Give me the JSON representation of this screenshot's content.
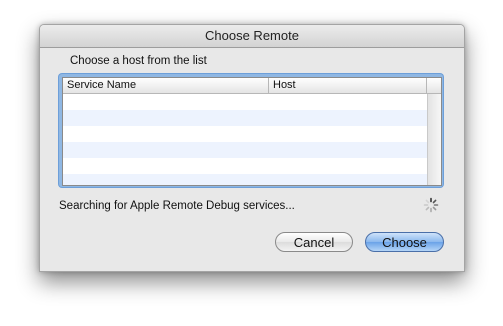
{
  "window": {
    "title": "Choose Remote"
  },
  "prompt": "Choose a host from the list",
  "table": {
    "columns": [
      "Service Name",
      "Host"
    ],
    "rows": []
  },
  "status": {
    "text": "Searching for Apple Remote Debug services..."
  },
  "buttons": {
    "cancel": "Cancel",
    "choose": "Choose"
  },
  "colors": {
    "accent": "#6aa2e8",
    "row_alt": "#edf3fe"
  },
  "icons": {
    "spinner": "progress-spinner-icon"
  }
}
